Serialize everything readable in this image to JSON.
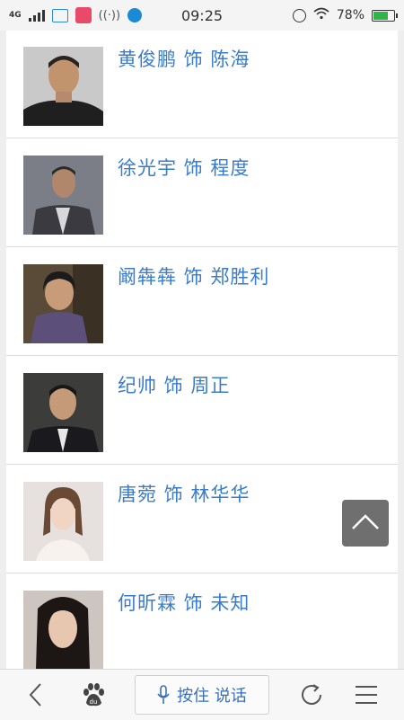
{
  "status_bar": {
    "network": "4G",
    "time": "09:25",
    "battery": "78%",
    "battery_level": 0.78
  },
  "cast_list": [
    {
      "label": "黄俊鹏 饰 陈海",
      "icon": "actor-photo"
    },
    {
      "label": "徐光宇 饰 程度",
      "icon": "actor-photo"
    },
    {
      "label": "阚犇犇 饰 郑胜利",
      "icon": "actor-photo"
    },
    {
      "label": "纪帅 饰 周正",
      "icon": "actor-photo"
    },
    {
      "label": "唐菀 饰 林华华",
      "icon": "actor-photo"
    },
    {
      "label": "何昕霖 饰 未知",
      "icon": "actor-photo"
    }
  ],
  "bottom_bar": {
    "voice_label": "按住 说话"
  },
  "colors": {
    "link_blue": "#3a7cc9",
    "back_to_top_bg": "#6f6f6f"
  }
}
